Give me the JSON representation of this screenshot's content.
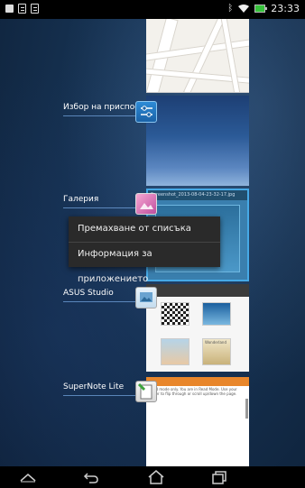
{
  "status_bar": {
    "time": "23:33",
    "battery_color": "#36c23b",
    "icons_left": [
      "gallery-icon",
      "document-icon",
      "edit-document-icon"
    ],
    "icons_right": [
      "bluetooth-icon",
      "wifi-icon",
      "battery-icon"
    ]
  },
  "recent_apps": [
    {
      "label": "",
      "thumbnail": "maps"
    },
    {
      "label": "Избор на приспособ",
      "icon": "settings-sliders-icon"
    },
    {
      "label": "Галерия",
      "icon": "gallery-icon",
      "thumb_title": "Screenshot_2013-08-04-23-32-17.jpg"
    },
    {
      "label": "ASUS Studio",
      "icon": "asus-studio-icon",
      "tile_caption": "Wonderland"
    },
    {
      "label": "SuperNote Lite",
      "icon": "supernote-icon",
      "thumb_text": "Read mode only. You are in Read Mode. Use your finger to flip through or scroll up/down the page."
    }
  ],
  "context_menu": {
    "items": [
      "Премахване от списъка",
      "Информация за приложението"
    ]
  },
  "nav_bar": {
    "buttons": [
      "collapse-icon",
      "back-icon",
      "home-icon",
      "recent-apps-icon"
    ]
  }
}
